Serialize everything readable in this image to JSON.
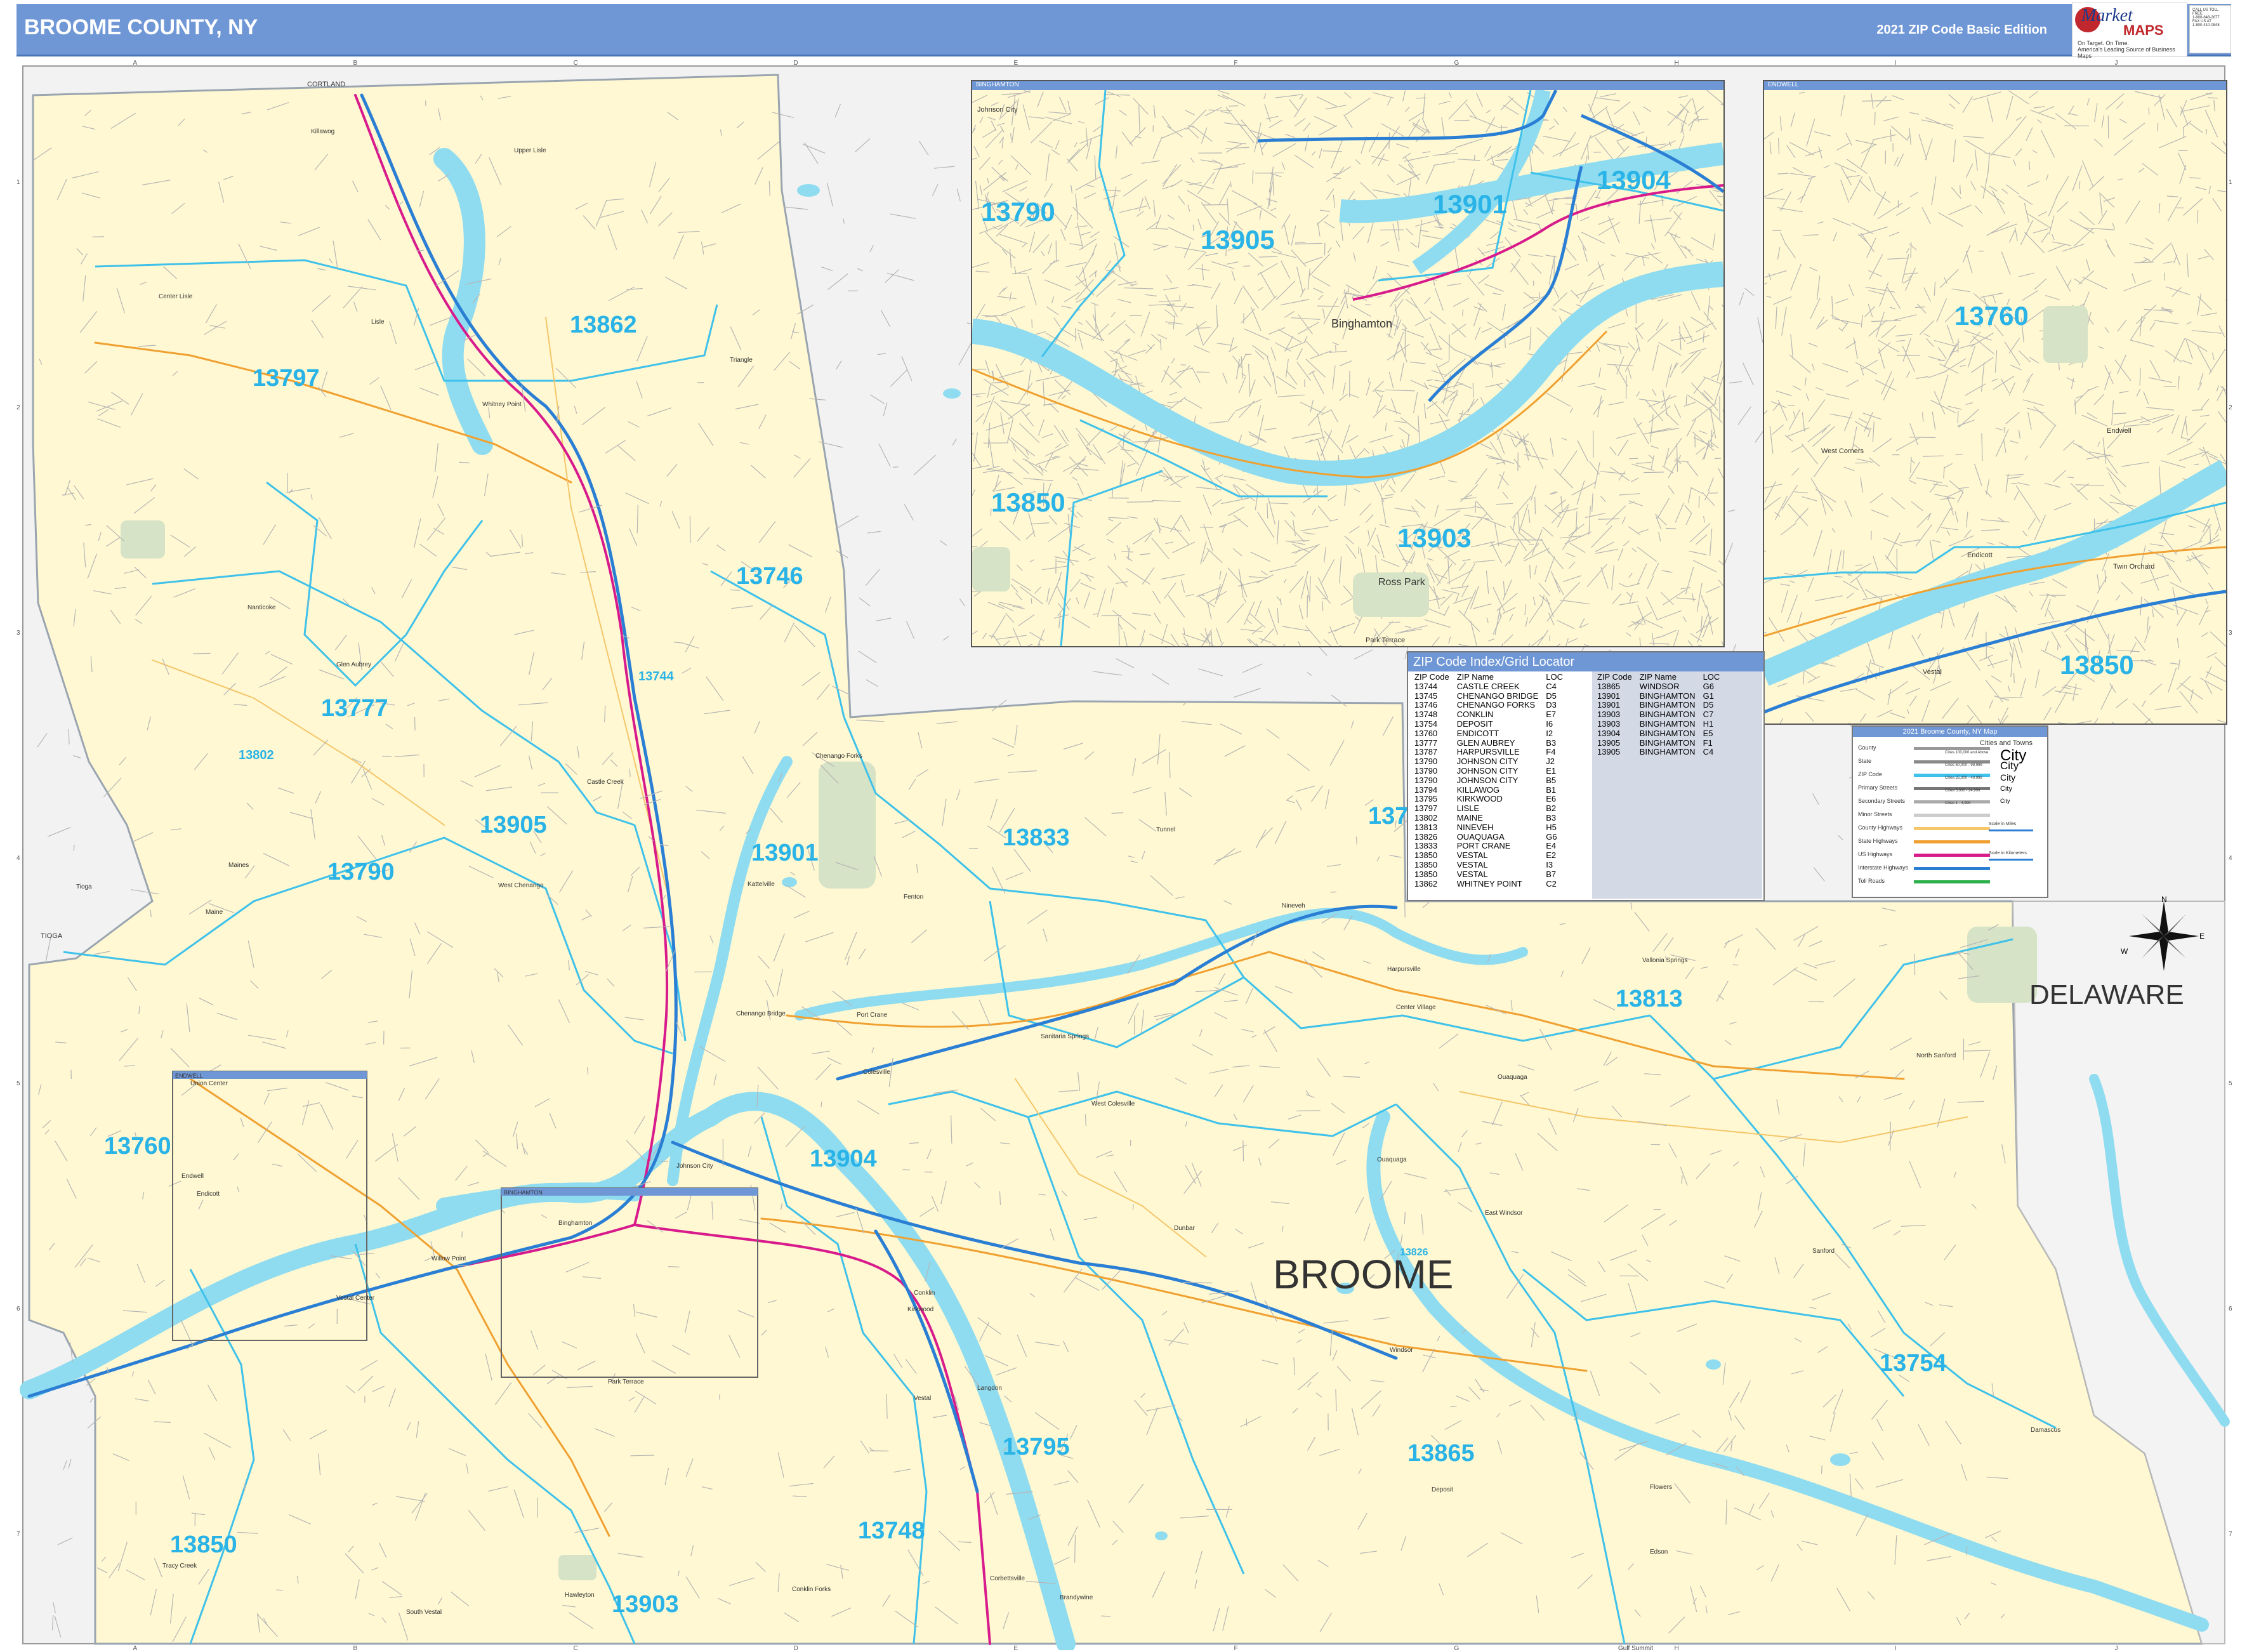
{
  "header": {
    "title": "BROOME COUNTY, NY",
    "edition": "2021 ZIP Code Basic Edition",
    "logo_line1": "Market",
    "logo_line2": "MAPS",
    "logo_tagline1": "On Target. On Time.",
    "logo_tagline2": "America's Leading Source of Business Maps",
    "contact_line1": "CALL US TOLL FREE",
    "contact_line2": "1-800-848-2877",
    "contact_line3": "FAX US AT",
    "contact_line4": "1-800-410-0848"
  },
  "grid": {
    "columns": [
      "A",
      "B",
      "C",
      "D",
      "E",
      "F",
      "G",
      "H",
      "I",
      "J"
    ],
    "rows": [
      "1",
      "2",
      "3",
      "4",
      "5",
      "6",
      "7"
    ]
  },
  "colors": {
    "land": "#fff8d2",
    "water": "#8fdcf0",
    "zip_boundary": "#3ec1ea",
    "zip_label": "#29b3e6",
    "header": "#6f97d6",
    "interstate": "#2a7fd4",
    "us_highway": "#d81b8c",
    "state_highway": "#f0a030",
    "county_highway": "#f5c66a",
    "park": "#d6e3c6"
  },
  "map": {
    "county_name": "BROOME",
    "neighbor_state": "DELAWARE",
    "top_label": "CORTLAND",
    "left_label": "TIOGA",
    "zip_labels": [
      "13797",
      "13862",
      "13746",
      "13744",
      "13777",
      "13802",
      "13905",
      "13790",
      "13901",
      "13833",
      "13787",
      "13813",
      "13760",
      "13904",
      "13850",
      "13795",
      "13748",
      "13903",
      "13865",
      "13754",
      "13826"
    ],
    "places": [
      "Killawog",
      "Upper Lisle",
      "Center Lisle",
      "Lisle",
      "Whitney Point",
      "Triangle",
      "Maine",
      "Nanticoke",
      "Glen Aubrey",
      "Castle Creek",
      "Chenango Forks",
      "Kattelville",
      "Fenton",
      "Tunnel",
      "Nineveh",
      "Harpursville",
      "Vallonia Springs",
      "Center Village",
      "Ouaquaga",
      "North Sanford",
      "West Chenango",
      "Chenango Bridge",
      "Port Crane",
      "Sanitaria Springs",
      "West Colesville",
      "Colesville",
      "Dunbar",
      "East Windsor",
      "Windsor",
      "Sanford",
      "Ouaquaga",
      "Conklin",
      "Kirkwood",
      "Langdon",
      "Corbettsville",
      "Vestal",
      "Park Terrace",
      "Binghamton",
      "Johnson City",
      "Endicott",
      "Union Center",
      "Endwell",
      "Vestal Center",
      "Tracy Creek",
      "Willow Point",
      "Tioga",
      "Maines",
      "Deposit",
      "Damascus",
      "Gulf Summit",
      "Flowers",
      "Edson",
      "Hawleyton",
      "South Vestal",
      "Conklin Forks",
      "Brandywine"
    ],
    "inset_binghamton_title": "BINGHAMTON",
    "inset_binghamton_zips": [
      "13790",
      "13905",
      "13901",
      "13904",
      "13850",
      "13903"
    ],
    "inset_binghamton_places": [
      "Binghamton",
      "Johnson City",
      "Ross Park",
      "Park Terrace"
    ],
    "inset_endwell_title": "ENDWELL",
    "inset_endwell_zips": [
      "13760",
      "13850"
    ],
    "inset_endwell_places": [
      "Endwell",
      "Endicott",
      "West Corners",
      "Twin Orchard",
      "Vestal"
    ],
    "small_inset_endwell_title": "ENDWELL",
    "small_inset_binghamton_title": "BINGHAMTON"
  },
  "zip_index": {
    "title": "ZIP Code Index/Grid Locator",
    "headers": [
      "ZIP Code",
      "ZIP Name",
      "LOC"
    ],
    "left": [
      [
        "13744",
        "CASTLE CREEK",
        "C4"
      ],
      [
        "13745",
        "CHENANGO BRIDGE",
        "D5"
      ],
      [
        "13746",
        "CHENANGO FORKS",
        "D3"
      ],
      [
        "13748",
        "CONKLIN",
        "E7"
      ],
      [
        "13754",
        "DEPOSIT",
        "I6"
      ],
      [
        "13760",
        "ENDICOTT",
        "I2"
      ],
      [
        "13777",
        "GLEN AUBREY",
        "B3"
      ],
      [
        "13787",
        "HARPURSVILLE",
        "F4"
      ],
      [
        "13790",
        "JOHNSON CITY",
        "J2"
      ],
      [
        "13790",
        "JOHNSON CITY",
        "E1"
      ],
      [
        "13790",
        "JOHNSON CITY",
        "B5"
      ],
      [
        "13794",
        "KILLAWOG",
        "B1"
      ],
      [
        "13795",
        "KIRKWOOD",
        "E6"
      ],
      [
        "13797",
        "LISLE",
        "B2"
      ],
      [
        "13802",
        "MAINE",
        "B3"
      ],
      [
        "13813",
        "NINEVEH",
        "H5"
      ],
      [
        "13826",
        "OUAQUAGA",
        "G6"
      ],
      [
        "13833",
        "PORT CRANE",
        "E4"
      ],
      [
        "13850",
        "VESTAL",
        "E2"
      ],
      [
        "13850",
        "VESTAL",
        "I3"
      ],
      [
        "13850",
        "VESTAL",
        "B7"
      ],
      [
        "13862",
        "WHITNEY POINT",
        "C2"
      ]
    ],
    "right": [
      [
        "13865",
        "WINDSOR",
        "G6"
      ],
      [
        "13901",
        "BINGHAMTON",
        "G1"
      ],
      [
        "13901",
        "BINGHAMTON",
        "D5"
      ],
      [
        "13903",
        "BINGHAMTON",
        "C7"
      ],
      [
        "13903",
        "BINGHAMTON",
        "H1"
      ],
      [
        "13904",
        "BINGHAMTON",
        "E5"
      ],
      [
        "13905",
        "BINGHAMTON",
        "F1"
      ],
      [
        "13905",
        "BINGHAMTON",
        "C4"
      ]
    ]
  },
  "legend": {
    "title": "2021 Broome County, NY Map",
    "items": [
      "County",
      "State",
      "ZIP Code",
      "Primary Streets",
      "Secondary Streets",
      "Minor Streets",
      "County Highways",
      "State Highways",
      "US Highways",
      "Interstate Highways",
      "Toll Roads"
    ],
    "cities_title": "Cities and Towns",
    "city_classes": [
      "Cities 100,000 and Above",
      "Cities 50,000 - 99,999",
      "Cities 25,000 - 49,999",
      "Cities 5,000 - 24,999",
      "Cities 1 - 4,999"
    ],
    "city_samples": [
      "City",
      "City",
      "City",
      "City",
      "City"
    ],
    "scale_miles": "Scale in Miles",
    "scale_km": "Scale in Kilometers"
  },
  "compass": {
    "n": "N",
    "e": "E",
    "w": "W"
  }
}
